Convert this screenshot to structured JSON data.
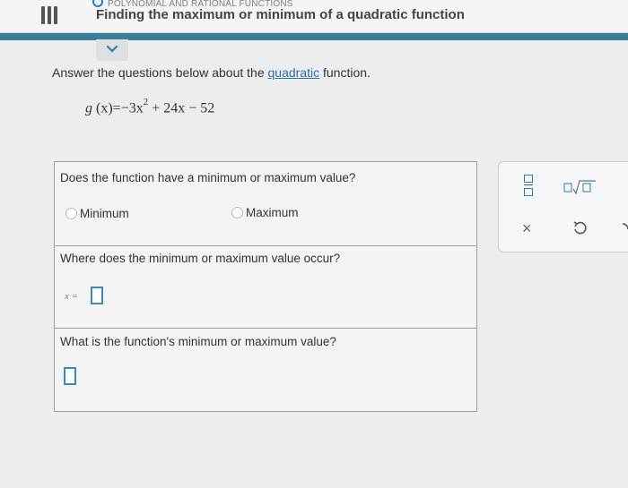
{
  "header": {
    "topic": "POLYNOMIAL AND RATIONAL FUNCTIONS",
    "title": "Finding the maximum or minimum of a quadratic function"
  },
  "intro": {
    "before": "Answer the questions below about the ",
    "link": "quadratic",
    "after": " function."
  },
  "equation": {
    "lhs_name": "g",
    "lhs_var": "(x)",
    "eq": "=",
    "term1": "−3x",
    "exp": "2",
    "term2": "+ 24x − 52"
  },
  "questions": {
    "q1": "Does the function have a minimum or maximum value?",
    "options": [
      "Minimum",
      "Maximum"
    ],
    "q2": "Where does the minimum or maximum value occur?",
    "q2_var": "x =",
    "q3": "What is the function's minimum or maximum value?"
  },
  "toolbar": {
    "icons": [
      "fraction-icon",
      "sqrt-icon",
      "clear-icon",
      "undo-icon",
      "redo-icon"
    ],
    "clear_glyph": "×"
  },
  "colors": {
    "accent": "#3b7f97",
    "link": "#2f6da8",
    "input_border": "#3a8ac2"
  }
}
